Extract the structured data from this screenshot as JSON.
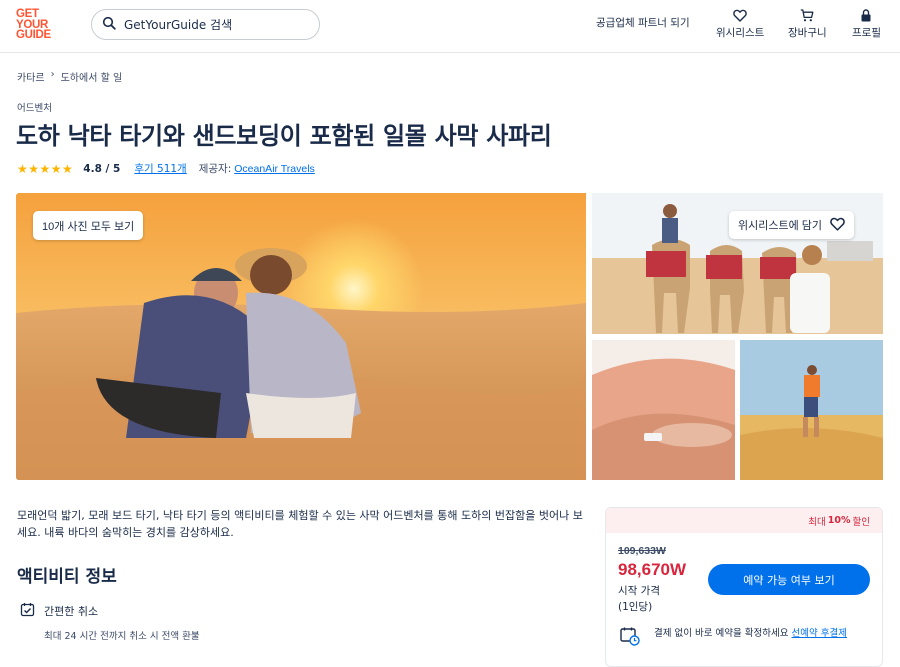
{
  "header": {
    "logo_lines": [
      "GET",
      "YOUR",
      "GUIDE"
    ],
    "search_placeholder": "GetYourGuide 검색",
    "partner_link": "공급업체 파트너 되기",
    "nav": {
      "wishlist": "위시리스트",
      "cart": "장바구니",
      "profile": "프로필"
    }
  },
  "breadcrumb": [
    "카타르",
    "도하에서 할 일"
  ],
  "activity": {
    "category": "어드벤처",
    "title": "도하 낙타 타기와 샌드보딩이 포함된 일몰 사막 사파리",
    "stars": "★★★★★",
    "rating": "4.8 / 5",
    "reviews_link": "후기 511개",
    "provider_label": "제공자:",
    "provider_name": "OceanAir Travels"
  },
  "gallery": {
    "view_all_button": "10개 사진 모두 보기",
    "wishlist_button": "위시리스트에 담기"
  },
  "description": "모래언덕 밟기, 모래 보드 타기, 낙타 타기 등의 액티비티를 체험할 수 있는 사막 어드벤처를 통해 도하의 번잡함을 벗어나 보세요. 내륙 바다의 숨막히는 경치를 감상하세요.",
  "about": {
    "section_title": "액티비티 정보",
    "free_cancellation": "간편한 취소",
    "free_cancellation_detail": "최대 24 시간 전까지 취소 시 전액 환불"
  },
  "booking": {
    "discount_prefix": "최대",
    "discount_value": "10%",
    "discount_suffix": "할인",
    "old_price": "109,633W",
    "price": "98,670W",
    "price_label": "시작 가격",
    "price_unit": "(1인당)",
    "check_button": "예약 가능 여부 보기",
    "reserve_text": "결제 없이 바로 예약을 확정하세요",
    "reserve_link": "선예약 후결제"
  },
  "colors": {
    "brand": "#ff5533",
    "primary": "#0071eb",
    "sale": "#d7263d",
    "text": "#1a2b49"
  }
}
